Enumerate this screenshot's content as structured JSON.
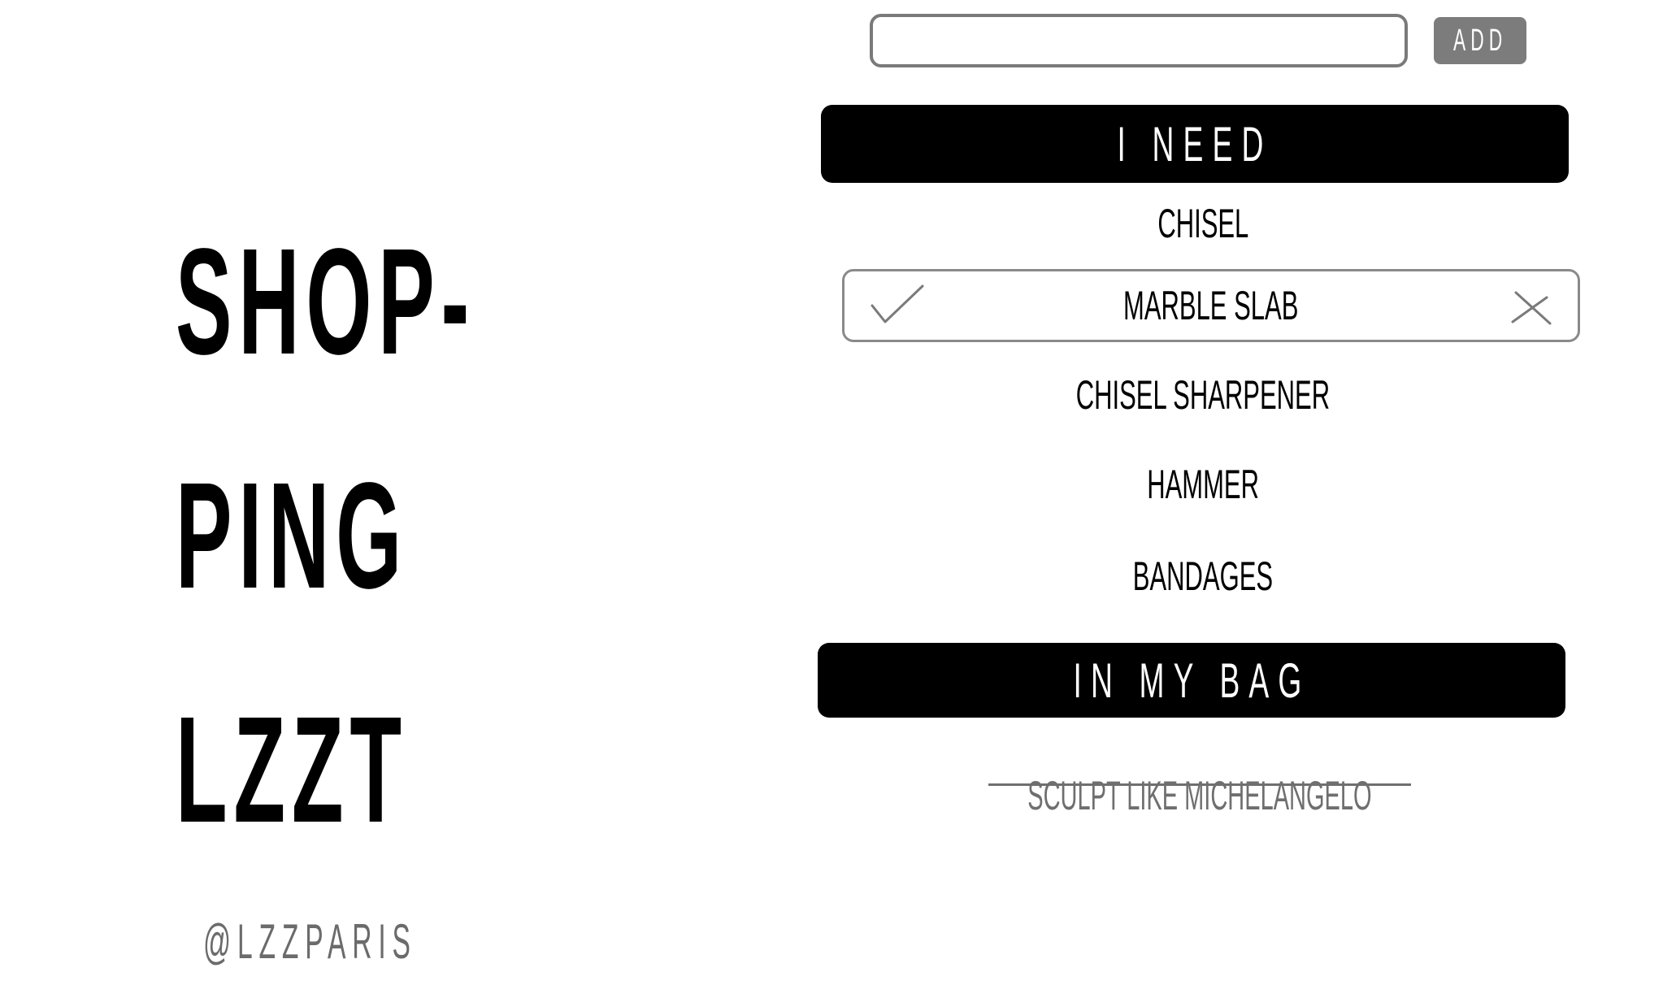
{
  "title": {
    "line1": "SHOP-",
    "line2": "PING",
    "line3": "LZZT"
  },
  "handle": "@LZZPARIS",
  "add_form": {
    "input_value": "",
    "placeholder": "",
    "button_label": "ADD"
  },
  "need_section": {
    "header": "I NEED",
    "items": [
      {
        "label": "CHISEL"
      },
      {
        "label": "MARBLE SLAB"
      },
      {
        "label": "CHISEL SHARPENER"
      },
      {
        "label": "HAMMER"
      },
      {
        "label": "BANDAGES"
      }
    ]
  },
  "bag_section": {
    "header": "IN MY BAG",
    "items": [
      {
        "label": "SCULPT LIKE MICHELANGELO"
      }
    ]
  },
  "icons": {
    "check": "check-icon",
    "delete": "close-icon"
  },
  "colors": {
    "header_bg": "#000000",
    "header_text": "#ffffff",
    "button_bg": "#7c7c7c",
    "done_text": "#6f6f6f",
    "border": "#8a8a8a"
  }
}
